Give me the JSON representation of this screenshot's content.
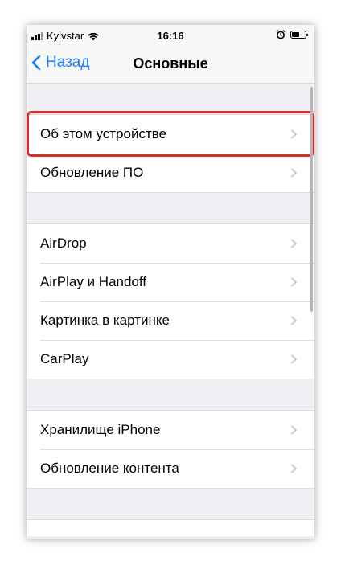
{
  "status_bar": {
    "carrier": "Kyivstar",
    "time": "16:16",
    "battery_level": 0.55
  },
  "navbar": {
    "back_label": "Назад",
    "title": "Основные"
  },
  "groups": [
    {
      "items": [
        {
          "label": "Об этом устройстве"
        },
        {
          "label": "Обновление ПО"
        }
      ]
    },
    {
      "items": [
        {
          "label": "AirDrop"
        },
        {
          "label": "AirPlay и Handoff"
        },
        {
          "label": "Картинка в картинке"
        },
        {
          "label": "CarPlay"
        }
      ]
    },
    {
      "items": [
        {
          "label": "Хранилище iPhone"
        },
        {
          "label": "Обновление контента"
        }
      ]
    }
  ],
  "colors": {
    "accent": "#1e7cf6",
    "highlight": "#d42f2f",
    "chevron": "#c4c4c7"
  },
  "icons": {
    "chevron": "chevron-right-icon",
    "back": "chevron-left-icon",
    "wifi": "wifi-icon",
    "alarm": "alarm-icon",
    "battery": "battery-icon",
    "signal": "signal-bars-icon"
  }
}
